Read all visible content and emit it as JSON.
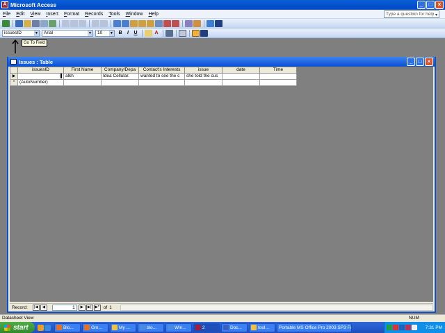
{
  "app": {
    "title": "Microsoft Access",
    "help_placeholder": "Type a question for help"
  },
  "menu": [
    "File",
    "Edit",
    "View",
    "Insert",
    "Format",
    "Records",
    "Tools",
    "Window",
    "Help"
  ],
  "formatting": {
    "field_combo": "issuesID",
    "font_combo": "Arial",
    "size_combo": "10"
  },
  "tooltip": "Go To Field",
  "child_window": {
    "title": "Issues : Table"
  },
  "datasheet": {
    "columns": [
      "issuesID",
      "First Name",
      "Company/Depa",
      "Contact's Interests",
      "issue",
      "date",
      "Time"
    ],
    "rows": [
      {
        "selector": "▶",
        "cells": [
          "",
          "alkh",
          "Idea Cellular.",
          "wanted to see the c",
          "she told the cus",
          "",
          ""
        ]
      },
      {
        "selector": "*",
        "cells": [
          "(AutoNumber)",
          "",
          "",
          "",
          "",
          "",
          ""
        ]
      }
    ]
  },
  "record_nav": {
    "label": "Record:",
    "current": "1",
    "of_label": "of",
    "total": "1"
  },
  "status": {
    "left": "Datasheet View",
    "num": "NUM"
  },
  "taskbar": {
    "start": "start",
    "tasks": [
      "Blo...",
      "Gm...",
      "My ...",
      "blo...",
      "Win...",
      "2",
      "Doc...",
      "tool...",
      "Portable MS Office Pro 2003 SP3 Full En"
    ],
    "clock": "7:31 PM"
  },
  "colors": {
    "titlebar": "#0a5fd8",
    "mdi_background": "#808080",
    "taskbar": "#245bd0",
    "start": "#2f8a2a"
  }
}
